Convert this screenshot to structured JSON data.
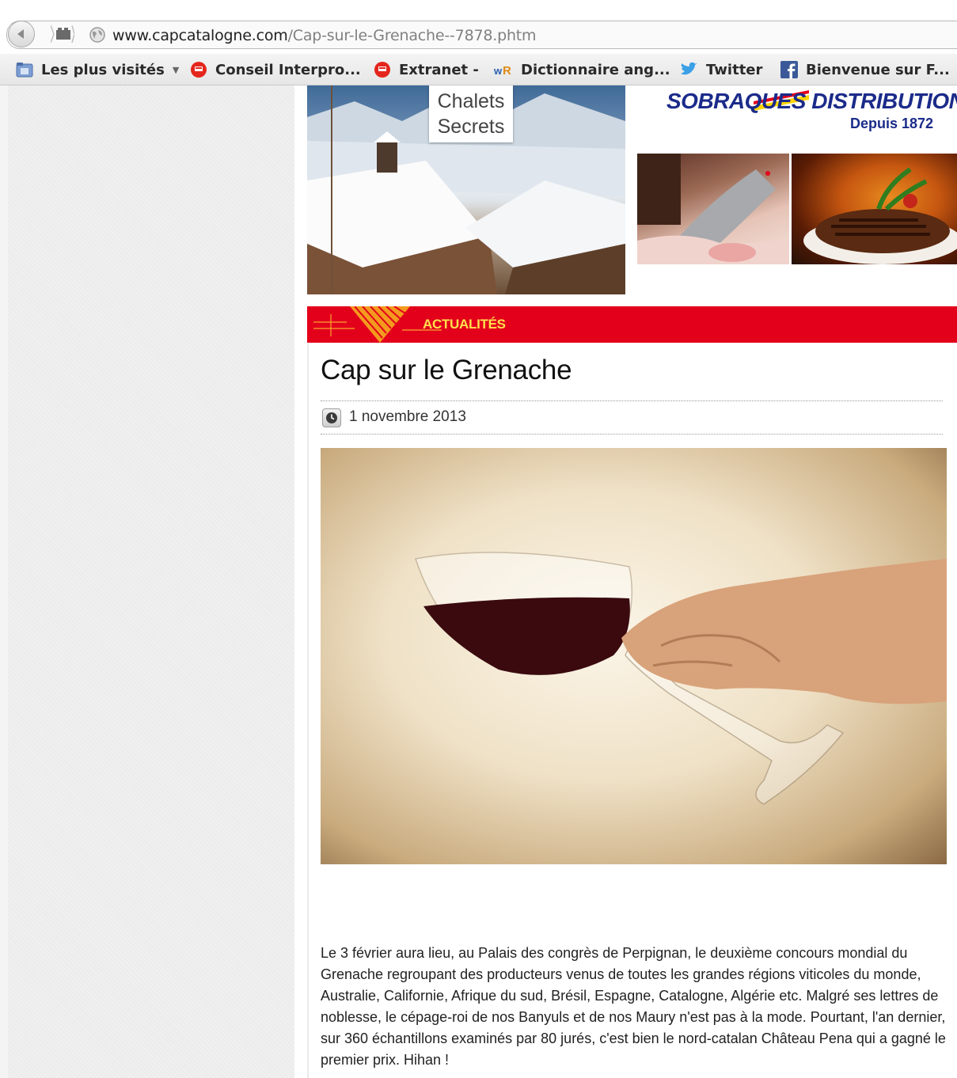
{
  "browser": {
    "url_host": "www.capcatalogne.com",
    "url_path": "/Cap-sur-le-Grenache--7878.phtm",
    "bookmarks": [
      {
        "label": "Les plus visités",
        "icon": "folder-icon",
        "has_dropdown": true
      },
      {
        "label": "Conseil Interpro...",
        "icon": "civr-logo-icon"
      },
      {
        "label": "Extranet -",
        "icon": "civr-logo-icon"
      },
      {
        "label": "Dictionnaire ang...",
        "icon": "wordreference-icon"
      },
      {
        "label": "Twitter",
        "icon": "twitter-bird-icon"
      },
      {
        "label": "Bienvenue sur F...",
        "icon": "facebook-icon"
      }
    ]
  },
  "ads": {
    "chalets": {
      "line1": "Chalets",
      "line2": "Secrets"
    },
    "sobraques": {
      "title": "SOBRAQUES DISTRIBUTION",
      "subtitle": "Depuis 1872"
    }
  },
  "section": {
    "label": "ACTUALITÉS",
    "color": "#e3001b",
    "label_color": "#ffe14d"
  },
  "article": {
    "title": "Cap sur le Grenache",
    "date": "1 novembre 2013",
    "body": "Le 3 février aura lieu, au Palais des congrès de Perpignan, le deuxième concours mondial du Grenache regroupant des producteurs venus de toutes les grandes régions viticoles du monde, Australie, Californie, Afrique du sud, Brésil, Espagne, Catalogne, Algérie etc. Malgré ses lettres de noblesse, le cépage-roi de nos Banyuls et de nos Maury n'est pas à la mode. Pourtant, l'an dernier, sur 360 échantillons examinés par 80 jurés, c'est bien le nord-catalan Château Pena qui a gagné le premier prix. Hihan !"
  }
}
